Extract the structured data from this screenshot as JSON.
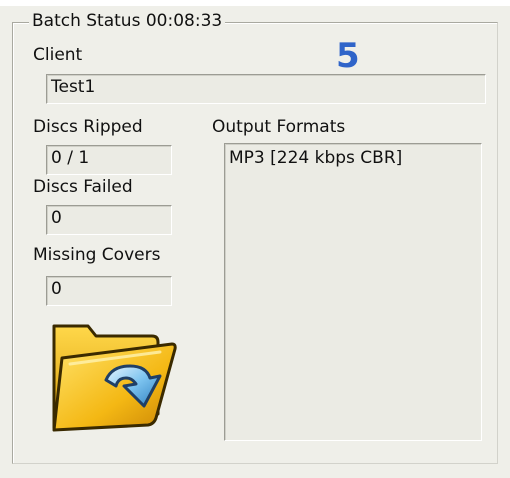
{
  "batch_status": {
    "title": "Batch Status 00:08:33",
    "step_number": "5",
    "client_label": "Client",
    "client_value": "Test1",
    "discs_ripped_label": "Discs Ripped",
    "discs_ripped_value": "0 / 1",
    "discs_failed_label": "Discs Failed",
    "discs_failed_value": "0",
    "missing_covers_label": "Missing Covers",
    "missing_covers_value": "0",
    "output_formats_label": "Output Formats",
    "output_formats": [
      "MP3 [224 kbps CBR]"
    ],
    "icon": "folder-arrow-icon"
  },
  "colors": {
    "window_bg": "#efefe9",
    "field_bg": "#ebebe4",
    "step_number": "#2f64c9",
    "folder_yellow": "#f2b81a",
    "arrow_blue": "#5aa8de"
  }
}
